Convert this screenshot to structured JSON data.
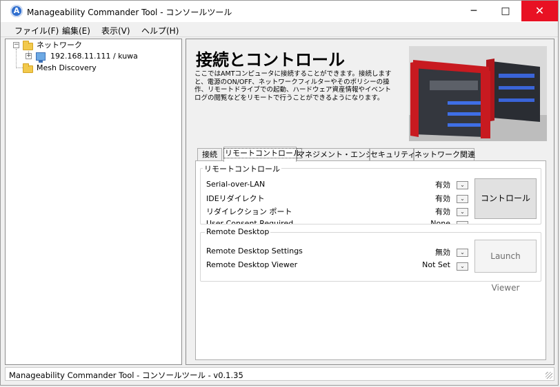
{
  "window": {
    "title": "Manageability Commander Tool - コンソールツール",
    "icon_letter": "A",
    "controls": {
      "minimize": "─",
      "maximize": "□",
      "close": "✕"
    }
  },
  "menu": [
    {
      "label": "ファイル(F)"
    },
    {
      "label": "編集(E)"
    },
    {
      "label": "表示(V)"
    },
    {
      "label": "ヘルプ(H)"
    }
  ],
  "tree": {
    "root": {
      "label": "ネットワーク",
      "expander": "−"
    },
    "host": {
      "label": "192.168.11.111 / kuwa",
      "expander": "+"
    },
    "mesh": {
      "label": "Mesh Discovery"
    }
  },
  "panel": {
    "heading": "接続とコントロール",
    "description": "ここではAMTコンピュータに接続することができます。接続しますと、電源のON/OFF、ネットワークフィルターやそのポリシーの操作、リモートドライブでの起動、ハードウェア資産情報やイベントログの閲覧などをリモートで行うことができるようになります。"
  },
  "tabs": [
    {
      "label": "接続",
      "active": false
    },
    {
      "label": "リモートコントロール",
      "active": true
    },
    {
      "label": "マネジメント・エンジン",
      "active": false
    },
    {
      "label": "セキュリティ",
      "active": false
    },
    {
      "label": "ネットワーク関連",
      "active": false
    }
  ],
  "remote_control": {
    "title": "リモートコントロール",
    "rows": [
      {
        "label": "Serial-over-LAN",
        "value": "有効"
      },
      {
        "label": "IDEリダイレクト",
        "value": "有効"
      },
      {
        "label": "リダイレクション ポート",
        "value": "有効"
      },
      {
        "label": "User Consent Required",
        "value": "None"
      }
    ],
    "button": "コントロール"
  },
  "remote_desktop": {
    "title": "Remote Desktop",
    "rows": [
      {
        "label": "Remote Desktop Settings",
        "value": "無効"
      },
      {
        "label": "Remote Desktop Viewer",
        "value": "Not Set"
      }
    ],
    "button": "Launch Viewer"
  },
  "dropdown_glyph": "⌄",
  "status": {
    "text": "Manageability Commander Tool - コンソールツール - v0.1.35"
  }
}
